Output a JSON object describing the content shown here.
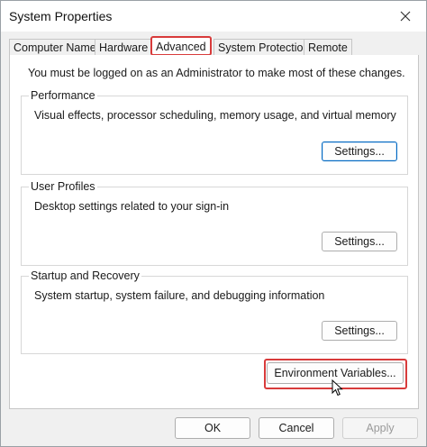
{
  "window": {
    "title": "System Properties"
  },
  "tabs": [
    {
      "label": "Computer Name"
    },
    {
      "label": "Hardware"
    },
    {
      "label": "Advanced"
    },
    {
      "label": "System Protection"
    },
    {
      "label": "Remote"
    }
  ],
  "active_tab": "Advanced",
  "admin_note": "You must be logged on as an Administrator to make most of these changes.",
  "performance": {
    "title": "Performance",
    "description": "Visual effects, processor scheduling, memory usage, and virtual memory",
    "button": "Settings..."
  },
  "user_profiles": {
    "title": "User Profiles",
    "description": "Desktop settings related to your sign-in",
    "button": "Settings..."
  },
  "startup_recovery": {
    "title": "Startup and Recovery",
    "description": "System startup, system failure, and debugging information",
    "button": "Settings..."
  },
  "env_button": "Environment Variables...",
  "footer": {
    "ok": "OK",
    "cancel": "Cancel",
    "apply": "Apply"
  },
  "colors": {
    "highlight": "#d83b3b",
    "focus": "#0067c0"
  },
  "icons": {
    "close": "close-icon",
    "cursor": "mouse-pointer-icon"
  }
}
